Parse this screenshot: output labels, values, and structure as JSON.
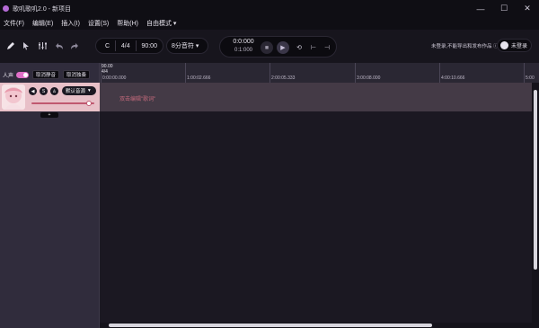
{
  "window": {
    "title": "歌叽歌叽2.0 - 新项目",
    "controls": [
      "—",
      "☐",
      "✕"
    ]
  },
  "menu": {
    "items": [
      "文件(F)",
      "编辑(E)",
      "插入(I)",
      "设置(S)",
      "帮助(H)",
      "自由模式 ▾"
    ]
  },
  "toolbar": {
    "key": "C",
    "meter": "4/4",
    "tempo": "90:00",
    "note_length": "8分音符 ▾",
    "time_main": "0:0:000",
    "time_sub": "0:1:000",
    "notice": "未登录,不能导出和发布作品 ⓘ",
    "login_label": "未登录"
  },
  "track": {
    "label": "人声",
    "mute_label": "取消静音",
    "solo_label": "取消独奏",
    "voice_label": "默认音源",
    "add_label": "+",
    "volume": 0.95
  },
  "ruler": {
    "tempo": "90.00",
    "meter": "4/4",
    "marks": [
      {
        "label": "0:00:00.000"
      },
      {
        "label": "1:00:02.666"
      },
      {
        "label": "2:00:05.333"
      },
      {
        "label": "3:00:08.000"
      },
      {
        "label": "4:00:10.666"
      },
      {
        "label": "5:00"
      }
    ]
  },
  "editor": {
    "hint": "双击编辑\"歌词\""
  },
  "colors": {
    "accent": "#e070c8",
    "track_bg": "#e8c0c8",
    "band_bg": "#443a46",
    "hint_text": "#c46a7c"
  }
}
